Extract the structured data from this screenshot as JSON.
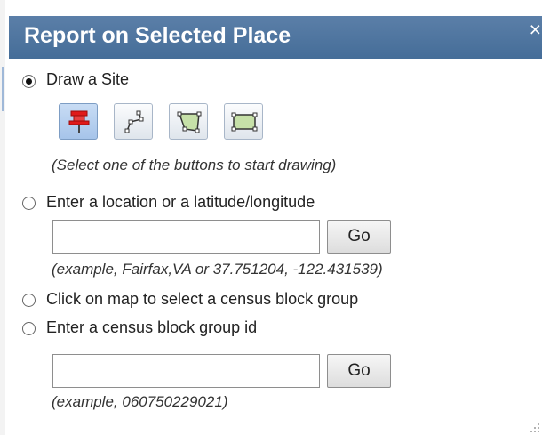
{
  "dialog": {
    "title": "Report on Selected Place",
    "close_glyph": "×"
  },
  "options": {
    "draw_site": {
      "label": "Draw a Site",
      "selected": true,
      "tools": [
        {
          "icon": "pushpin-icon",
          "active": true
        },
        {
          "icon": "draw-line-icon",
          "active": false
        },
        {
          "icon": "draw-polygon-icon",
          "active": false
        },
        {
          "icon": "draw-rectangle-icon",
          "active": false
        }
      ],
      "hint": "(Select one of the buttons to start drawing)"
    },
    "location": {
      "label": "Enter a location or a latitude/longitude",
      "selected": false,
      "input_value": "",
      "go_label": "Go",
      "hint": "(example, Fairfax,VA or 37.751204, -122.431539)"
    },
    "map_click": {
      "label": "Click on map to select a census block group",
      "selected": false
    },
    "block_group": {
      "label": "Enter a census block group id",
      "selected": false,
      "input_value": "",
      "go_label": "Go",
      "hint": "(example, 060750229021)"
    }
  },
  "colors": {
    "title_bar": "#4f75a0",
    "active_tool": "#b4cdee",
    "pushpin": "#e01a1a",
    "shape_fill": "#c6e0a8"
  }
}
